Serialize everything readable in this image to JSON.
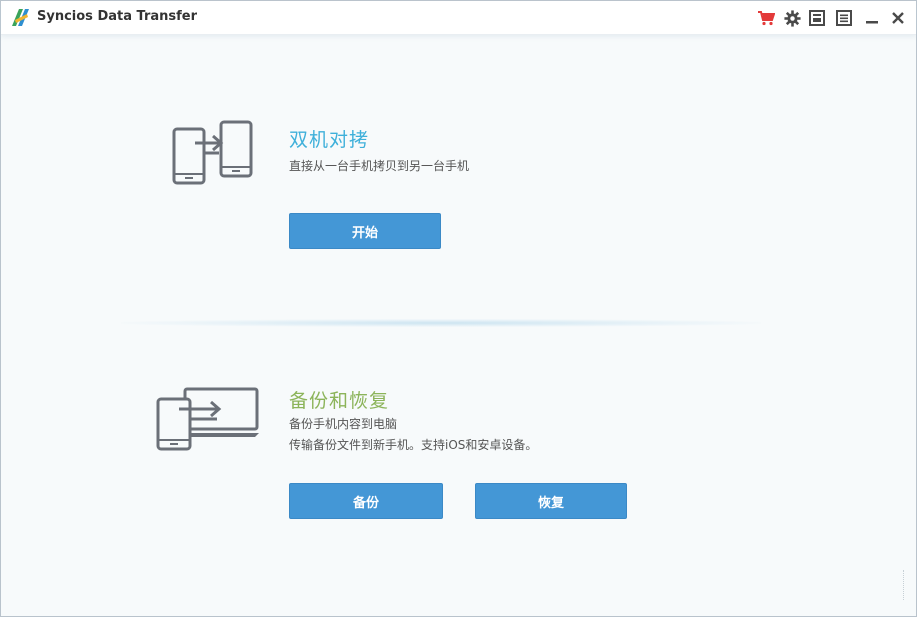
{
  "window": {
    "title": "Syncios Data Transfer"
  },
  "toolbar": {
    "icons": [
      "cart-icon",
      "gear-icon",
      "register-icon",
      "menu-icon",
      "minimize-icon",
      "close-icon"
    ],
    "cart_color": "#e33a3a",
    "icon_color": "#4a4a4a"
  },
  "transfer": {
    "title": "双机对拷",
    "description": "直接从一台手机拷贝到另一台手机",
    "start_label": "开始"
  },
  "backup": {
    "title": "备份和恢复",
    "description_line1": "备份手机内容到电脑",
    "description_line2": "传输备份文件到新手机。支持iOS和安卓设备。",
    "backup_label": "备份",
    "restore_label": "恢复"
  },
  "colors": {
    "accent_blue": "#3fb0da",
    "accent_green": "#8cb45a",
    "button": "#4497d6"
  }
}
